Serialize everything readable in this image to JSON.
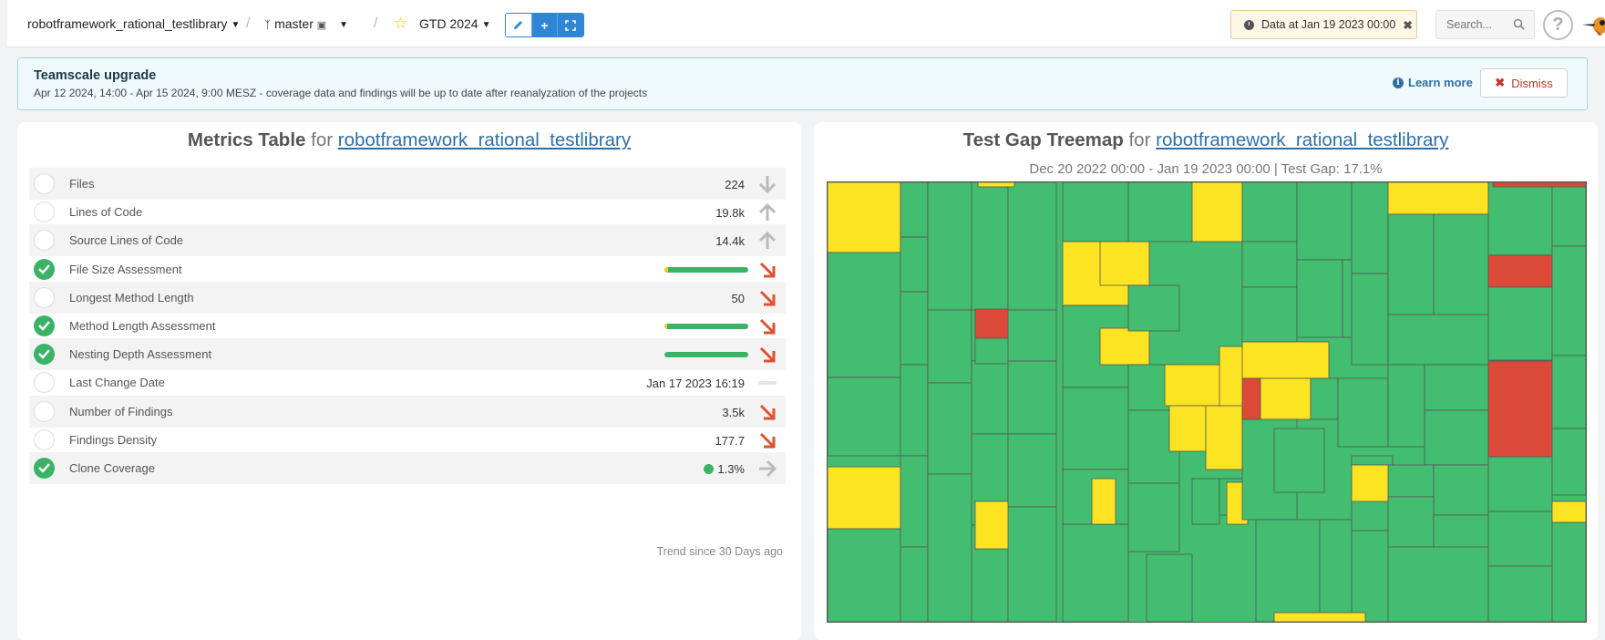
{
  "topbar": {
    "project": "robotframework_rational_testlibrary",
    "branch": "master",
    "dashboard": "GTD 2024",
    "data_at": "Data at Jan 19 2023 00:00",
    "search_placeholder": "Search...",
    "help": "?"
  },
  "banner": {
    "title": "Teamscale upgrade",
    "text": "Apr 12 2024, 14:00 - Apr 15 2024, 9:00 MESZ - coverage data and findings will be up to date after reanalyzation of the projects",
    "learn_more": "Learn more",
    "dismiss": "Dismiss"
  },
  "metrics": {
    "title": "Metrics Table",
    "for": "for",
    "project_link": "robotframework_rational_testlibrary",
    "trend_note": "Trend since 30 Days ago",
    "rows": [
      {
        "label": "Files",
        "value": "224",
        "status": "none",
        "trend": "down-gray"
      },
      {
        "label": "Lines of Code",
        "value": "19.8k",
        "status": "none",
        "trend": "up-gray"
      },
      {
        "label": "Source Lines of Code",
        "value": "14.4k",
        "status": "none",
        "trend": "up-gray"
      },
      {
        "label": "File Size Assessment",
        "value": "",
        "status": "ok",
        "trend": "down-red",
        "assessment_yellow_fraction": 0.04
      },
      {
        "label": "Longest Method Length",
        "value": "50",
        "status": "none",
        "trend": "down-red"
      },
      {
        "label": "Method Length Assessment",
        "value": "",
        "status": "ok",
        "trend": "down-red",
        "assessment_yellow_fraction": 0.03
      },
      {
        "label": "Nesting Depth Assessment",
        "value": "",
        "status": "ok",
        "trend": "down-red",
        "assessment_yellow_fraction": 0.0
      },
      {
        "label": "Last Change Date",
        "value": "Jan 17 2023 16:19",
        "status": "none",
        "trend": "none"
      },
      {
        "label": "Number of Findings",
        "value": "3.5k",
        "status": "none",
        "trend": "down-red"
      },
      {
        "label": "Findings Density",
        "value": "177.7",
        "status": "none",
        "trend": "down-red"
      },
      {
        "label": "Clone Coverage",
        "value": "1.3%",
        "status": "ok",
        "trend": "right-gray"
      }
    ]
  },
  "treemap": {
    "title": "Test Gap Treemap",
    "for": "for",
    "project_link": "robotframework_rational_testlibrary",
    "subtitle": "Dec 20 2022 00:00 - Jan 19 2023 00:00 | Test Gap: 17.1%",
    "colors": {
      "tested": "#43bd6f",
      "untested_changed": "#fde423",
      "untested_new": "#db4a39",
      "border": "#555555"
    }
  }
}
